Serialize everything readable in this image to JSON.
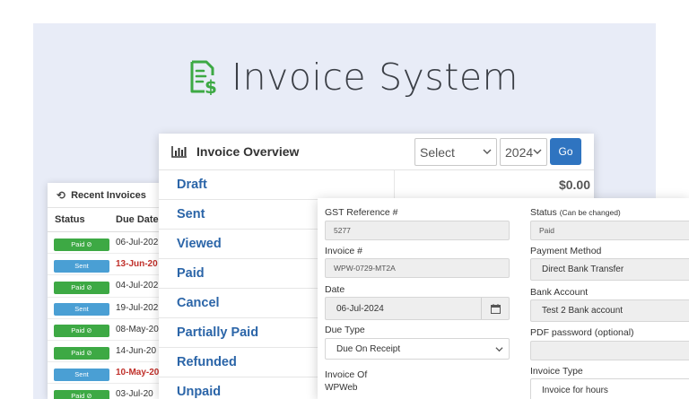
{
  "brand": {
    "word1": "Invoice",
    "word2": "System",
    "icon": "invoice-dollar-icon",
    "accent": "#3da944"
  },
  "recent": {
    "title": "Recent Invoices",
    "icon": "history-icon",
    "columns": [
      "Status",
      "Due Date"
    ],
    "rows": [
      {
        "status": "Paid ⊘",
        "type": "paid",
        "date": "06-Jul-202",
        "overdue": false
      },
      {
        "status": "Sent",
        "type": "sent",
        "date": "13-Jun-20",
        "overdue": true
      },
      {
        "status": "Paid ⊘",
        "type": "paid",
        "date": "04-Jul-202",
        "overdue": false
      },
      {
        "status": "Sent",
        "type": "sent",
        "date": "19-Jul-202",
        "overdue": false
      },
      {
        "status": "Paid ⊘",
        "type": "paid",
        "date": "08-May-20",
        "overdue": false
      },
      {
        "status": "Paid ⊘",
        "type": "paid",
        "date": "14-Jun-20",
        "overdue": false
      },
      {
        "status": "Sent",
        "type": "sent",
        "date": "10-May-20",
        "overdue": true
      },
      {
        "status": "Paid ⊘",
        "type": "paid",
        "date": "03-Jul-20",
        "overdue": false
      }
    ]
  },
  "overview": {
    "title": "Invoice Overview",
    "icon": "bar-chart-icon",
    "month_select": "Select",
    "year_select": "2024",
    "go_label": "Go",
    "statuses": [
      "Draft",
      "Sent",
      "Viewed",
      "Paid",
      "Cancel",
      "Partially Paid",
      "Refunded",
      "Unpaid"
    ],
    "draft_amount": "$0.00"
  },
  "form": {
    "gst_label": "GST Reference #",
    "gst_value": "5277",
    "invoice_no_label": "Invoice #",
    "invoice_no_value": "WPW-0729-MT2A",
    "date_label": "Date",
    "date_value": "06-Jul-2024",
    "due_type_label": "Due Type",
    "due_type_value": "Due On Receipt",
    "invoice_of_label": "Invoice Of",
    "invoice_of_value": "WPWeb",
    "status_label": "Status",
    "status_note": "(Can be changed)",
    "status_value": "Paid",
    "payment_method_label": "Payment Method",
    "payment_method_value": "Direct Bank Transfer",
    "bank_account_label": "Bank Account",
    "bank_account_value": "Test 2 Bank account",
    "pdf_password_label": "PDF password (optional)",
    "pdf_password_value": "",
    "invoice_type_label": "Invoice Type",
    "invoice_type_value": "Invoice for hours"
  }
}
